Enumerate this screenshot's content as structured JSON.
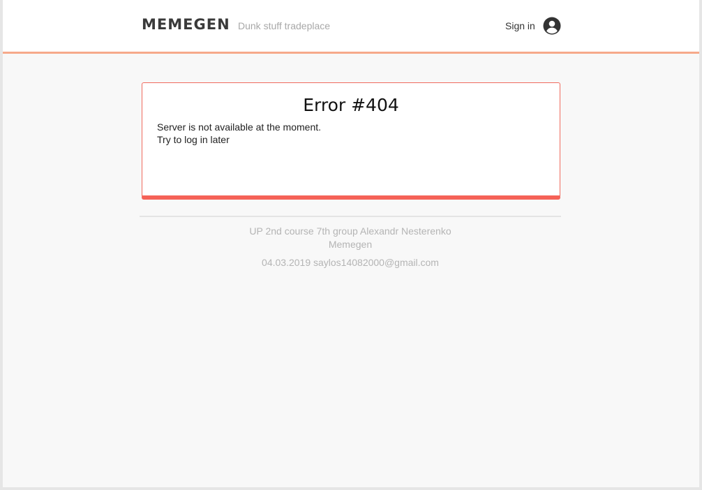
{
  "header": {
    "logo": "MEMEGEN",
    "tagline": "Dunk stuff tradeplace",
    "sign_in_label": "Sign in",
    "user_icon": "account-circle-icon"
  },
  "error": {
    "title": "Error #404",
    "message_line1": "Server is not available at the moment.",
    "message_line2": "Try to log in later"
  },
  "footer": {
    "line1": "UP 2nd course 7th group Alexandr Nesterenko",
    "line2": "Memegen",
    "line3": "04.03.2019 saylos14082000@gmail.com"
  },
  "colors": {
    "header_accent": "#f6a98a",
    "error_border": "#f06a5e",
    "error_bar": "#f56257",
    "page_background": "#f8f8f8"
  }
}
